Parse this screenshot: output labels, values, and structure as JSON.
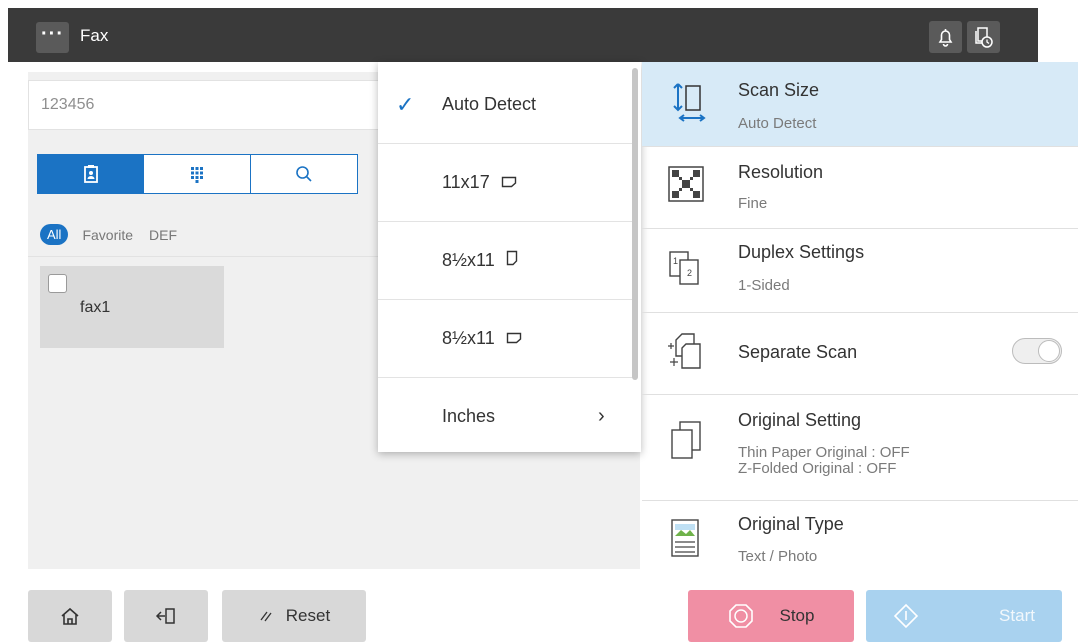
{
  "app": {
    "title": "Fax",
    "menu_glyph": "···"
  },
  "topbar_icons": [
    "bell-icon",
    "job-list-icon"
  ],
  "destination": {
    "value": "123456"
  },
  "address_tabs": [
    {
      "name": "address-book-icon",
      "active": true
    },
    {
      "name": "keypad-icon",
      "active": false
    },
    {
      "name": "search-icon",
      "active": false
    }
  ],
  "filters": {
    "all": "All",
    "items": [
      "Favorite",
      "DEF"
    ]
  },
  "destinations": [
    {
      "name": "fax1"
    }
  ],
  "scan_size_menu": {
    "items": [
      {
        "label": "Auto Detect",
        "selected": true
      },
      {
        "label": "11x17",
        "orientation": "landscape"
      },
      {
        "label": "8½x11",
        "orientation": "portrait"
      },
      {
        "label": "8½x11",
        "orientation": "landscape"
      },
      {
        "label": "Inches",
        "submenu": true
      }
    ]
  },
  "settings": [
    {
      "title": "Scan Size",
      "sub": "Auto Detect",
      "icon": "scan-size-icon",
      "active": true
    },
    {
      "title": "Resolution",
      "sub": "Fine",
      "icon": "resolution-icon"
    },
    {
      "title": "Duplex Settings",
      "sub": "1-Sided",
      "icon": "duplex-icon"
    },
    {
      "title": "Separate Scan",
      "icon": "separate-scan-icon",
      "toggle": false
    },
    {
      "title": "Original Setting",
      "sub": [
        "Thin Paper Original : OFF",
        "Z-Folded Original : OFF"
      ],
      "icon": "original-setting-icon"
    },
    {
      "title": "Original Type",
      "sub": "Text / Photo",
      "icon": "original-type-icon"
    }
  ],
  "bottom": {
    "reset": "Reset",
    "stop": "Stop",
    "start": "Start"
  },
  "colors": {
    "accent": "#1b73c4",
    "selected_row": "#d7eaf7",
    "stop": "#f08fa4",
    "start": "#a9d2ef",
    "topbar": "#3a3a3a"
  }
}
